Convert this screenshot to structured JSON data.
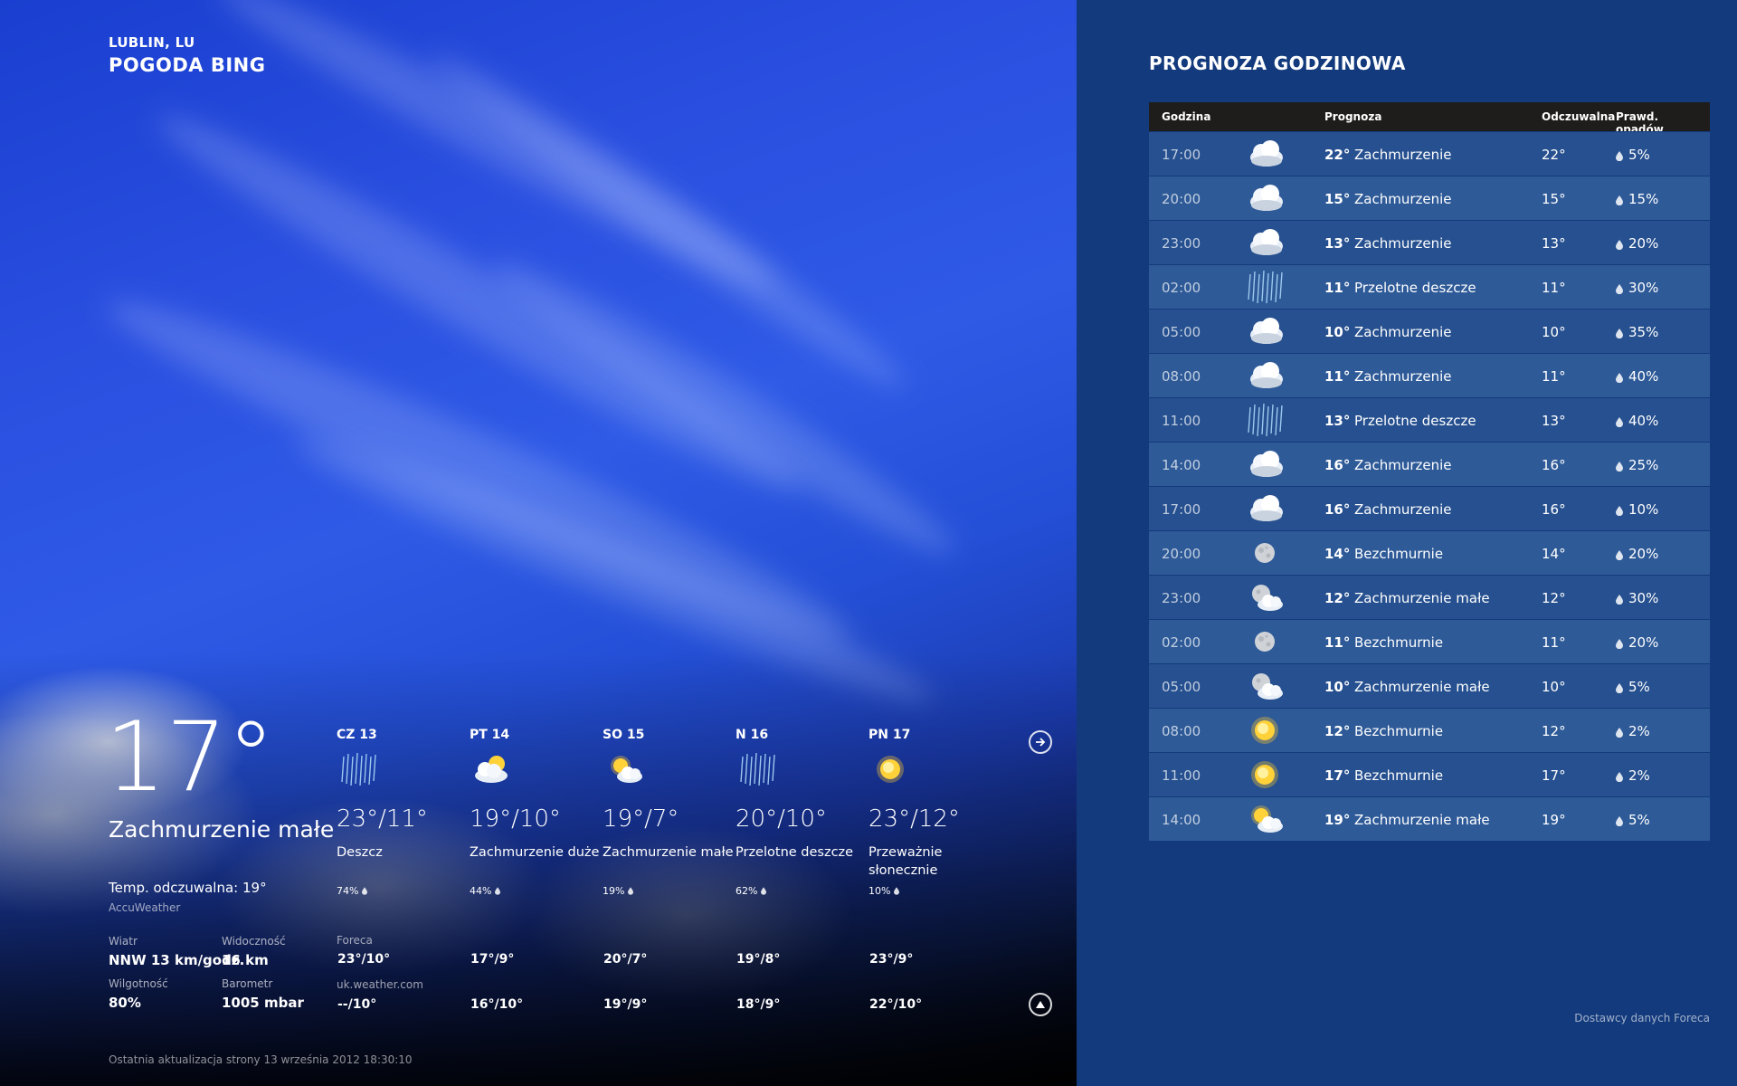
{
  "header": {
    "location": "LUBLIN, LU",
    "app_title": "POGODA BING"
  },
  "current": {
    "temp": "17°",
    "condition": "Zachmurzenie małe",
    "feels_like": "Temp. odczuwalna: 19°",
    "source": "AccuWeather",
    "wind_label": "Wiatr",
    "wind": "NNW 13 km/godz.",
    "visibility_label": "Widoczność",
    "visibility": "16 km",
    "humidity_label": "Wilgotność",
    "humidity": "80%",
    "barometer_label": "Barometr",
    "barometer": "1005 mbar"
  },
  "daily": [
    {
      "name": "CZ 13",
      "icon": "rain-icon",
      "temp": "23°/11°",
      "cond": "Deszcz",
      "precip": "74%",
      "foreca": "23°/10°",
      "ukweather": "--/10°"
    },
    {
      "name": "PT 14",
      "icon": "partly-cloudy-icon",
      "temp": "19°/10°",
      "cond": "Zachmurzenie duże",
      "precip": "44%",
      "foreca": "17°/9°",
      "ukweather": "16°/10°"
    },
    {
      "name": "SO 15",
      "icon": "sun-cloud-icon",
      "temp": "19°/7°",
      "cond": "Zachmurzenie małe",
      "precip": "19%",
      "foreca": "20°/7°",
      "ukweather": "19°/9°"
    },
    {
      "name": "N 16",
      "icon": "rain-icon",
      "temp": "20°/10°",
      "cond": "Przelotne deszcze",
      "precip": "62%",
      "foreca": "19°/8°",
      "ukweather": "18°/9°"
    },
    {
      "name": "PN 17",
      "icon": "sun-icon",
      "temp": "23°/12°",
      "cond": "Przeważnie słonecznie",
      "precip": "10%",
      "foreca": "23°/9°",
      "ukweather": "22°/10°"
    }
  ],
  "sources": {
    "foreca": "Foreca",
    "ukweather": "uk.weather.com"
  },
  "footer": {
    "updated": "Ostatnia aktualizacja strony 13 września 2012 18:30:10"
  },
  "hourly": {
    "title": "PROGNOZA GODZINOWA",
    "headers": {
      "time": "Godzina",
      "forecast": "Prognoza",
      "feels": "Odczuwalna",
      "precip": "Prawd. opadów"
    },
    "rows": [
      {
        "time": "17:00",
        "icon": "cloud-icon",
        "temp": "22°",
        "cond": "Zachmurzenie",
        "feels": "22°",
        "precip": "5%"
      },
      {
        "time": "20:00",
        "icon": "cloud-icon",
        "temp": "15°",
        "cond": "Zachmurzenie",
        "feels": "15°",
        "precip": "15%"
      },
      {
        "time": "23:00",
        "icon": "cloud-icon",
        "temp": "13°",
        "cond": "Zachmurzenie",
        "feels": "13°",
        "precip": "20%"
      },
      {
        "time": "02:00",
        "icon": "rain-icon",
        "temp": "11°",
        "cond": "Przelotne deszcze",
        "feels": "11°",
        "precip": "30%"
      },
      {
        "time": "05:00",
        "icon": "cloud-icon",
        "temp": "10°",
        "cond": "Zachmurzenie",
        "feels": "10°",
        "precip": "35%"
      },
      {
        "time": "08:00",
        "icon": "cloud-icon",
        "temp": "11°",
        "cond": "Zachmurzenie",
        "feels": "11°",
        "precip": "40%"
      },
      {
        "time": "11:00",
        "icon": "rain-icon",
        "temp": "13°",
        "cond": "Przelotne deszcze",
        "feels": "13°",
        "precip": "40%"
      },
      {
        "time": "14:00",
        "icon": "cloud-icon",
        "temp": "16°",
        "cond": "Zachmurzenie",
        "feels": "16°",
        "precip": "25%"
      },
      {
        "time": "17:00",
        "icon": "cloud-icon",
        "temp": "16°",
        "cond": "Zachmurzenie",
        "feels": "16°",
        "precip": "10%"
      },
      {
        "time": "20:00",
        "icon": "moon-icon",
        "temp": "14°",
        "cond": "Bezchmurnie",
        "feels": "14°",
        "precip": "20%"
      },
      {
        "time": "23:00",
        "icon": "moon-cloud-icon",
        "temp": "12°",
        "cond": "Zachmurzenie małe",
        "feels": "12°",
        "precip": "30%"
      },
      {
        "time": "02:00",
        "icon": "moon-icon",
        "temp": "11°",
        "cond": "Bezchmurnie",
        "feels": "11°",
        "precip": "20%"
      },
      {
        "time": "05:00",
        "icon": "moon-cloud-icon",
        "temp": "10°",
        "cond": "Zachmurzenie małe",
        "feels": "10°",
        "precip": "5%"
      },
      {
        "time": "08:00",
        "icon": "sun-icon",
        "temp": "12°",
        "cond": "Bezchmurnie",
        "feels": "12°",
        "precip": "2%"
      },
      {
        "time": "11:00",
        "icon": "sun-icon",
        "temp": "17°",
        "cond": "Bezchmurnie",
        "feels": "17°",
        "precip": "2%"
      },
      {
        "time": "14:00",
        "icon": "sun-cloud-icon",
        "temp": "19°",
        "cond": "Zachmurzenie małe",
        "feels": "19°",
        "precip": "5%"
      }
    ],
    "providers": "Dostawcy danych Foreca"
  }
}
